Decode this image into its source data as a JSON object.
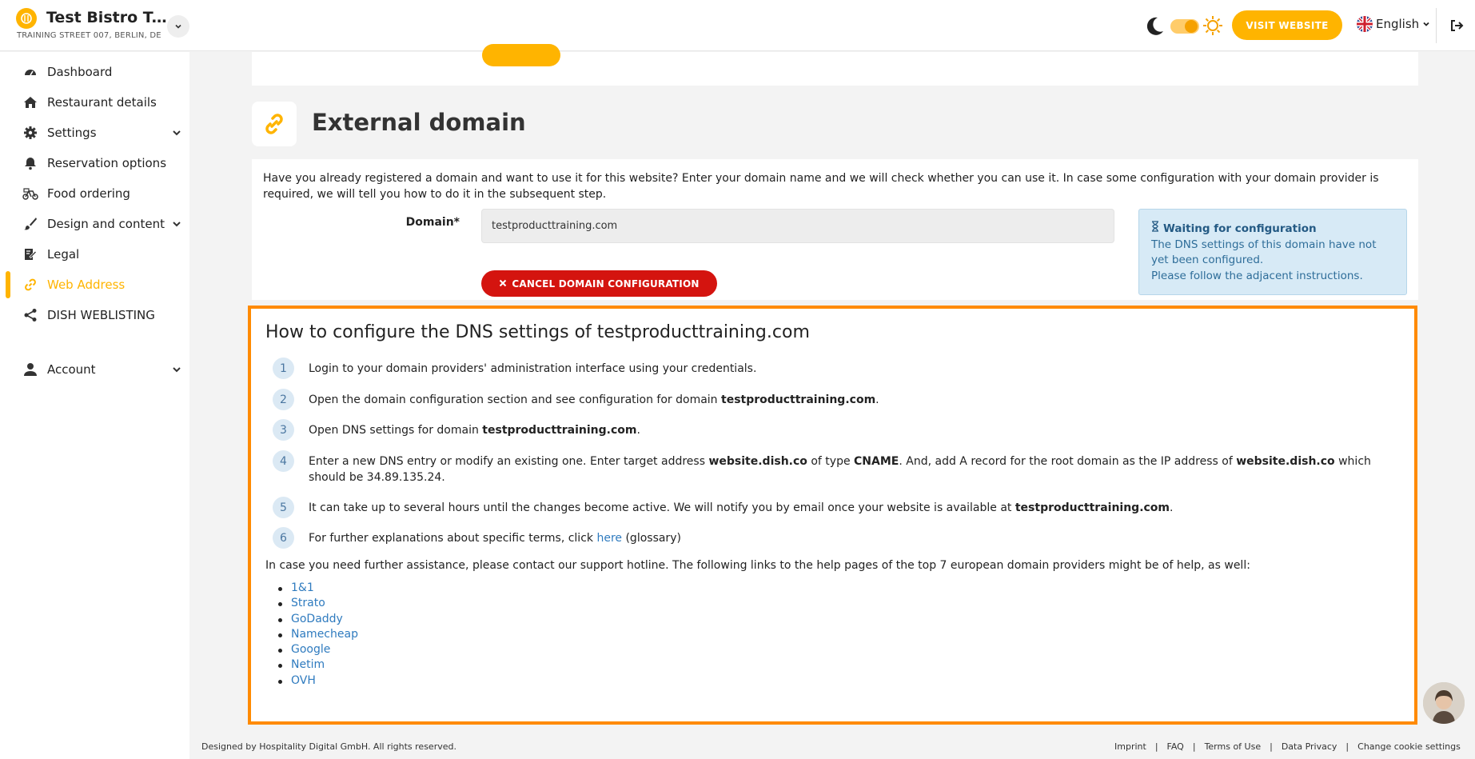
{
  "header": {
    "restaurant_name": "Test Bistro Train...",
    "restaurant_address": "TRAINING STREET 007, BERLIN, DE",
    "visit_website_label": "VISIT WEBSITE",
    "language_label": "English"
  },
  "sidebar": {
    "items": [
      {
        "label": "Dashboard",
        "icon": "dashboard-icon"
      },
      {
        "label": "Restaurant details",
        "icon": "home-icon"
      },
      {
        "label": "Settings",
        "icon": "gear-icon"
      },
      {
        "label": "Reservation options",
        "icon": "bell-icon"
      },
      {
        "label": "Food ordering",
        "icon": "bike-icon"
      },
      {
        "label": "Design and content",
        "icon": "brush-icon"
      },
      {
        "label": "Legal",
        "icon": "legal-icon"
      },
      {
        "label": "Web Address",
        "icon": "link-icon"
      },
      {
        "label": "DISH WEBLISTING",
        "icon": "share-icon"
      },
      {
        "label": "Account",
        "icon": "user-icon"
      }
    ]
  },
  "main": {
    "section_title": "External domain",
    "intro_text": "Have you already registered a domain and want to use it for this website? Enter your domain name and we will check whether you can use it. In case some configuration with your domain provider is required, we will tell you how to do it in the subsequent step.",
    "domain_label": "Domain*",
    "domain_value": "testproducttraining.com",
    "cancel_button_label": "CANCEL DOMAIN CONFIGURATION",
    "status": {
      "title": "Waiting for configuration",
      "line1": "The DNS settings of this domain have not yet been configured.",
      "line2": "Please follow the adjacent instructions."
    }
  },
  "instructions": {
    "title": "How to configure the DNS settings of testproducttraining.com",
    "steps": [
      {
        "num": "1",
        "text": "Login to your domain providers' administration interface using your credentials."
      },
      {
        "num": "2",
        "pre": "Open the domain configuration section and see configuration for domain ",
        "bold": "testproducttraining.com",
        "post": "."
      },
      {
        "num": "3",
        "pre": "Open DNS settings for domain ",
        "bold": "testproducttraining.com",
        "post": "."
      },
      {
        "num": "4",
        "p1": "Enter a new DNS entry or modify an existing one. Enter target address ",
        "b1": "website.dish.co",
        "p2": " of type ",
        "b2": "CNAME",
        "p3": ". And, add A record for the root domain as the IP address of ",
        "b3": "website.dish.co",
        "p4": " which should be 34.89.135.24."
      },
      {
        "num": "5",
        "pre": "It can take up to several hours until the changes become active. We will notify you by email once your website is available at ",
        "bold": "testproducttraining.com",
        "post": "."
      },
      {
        "num": "6",
        "pre": "For further explanations about specific terms, click ",
        "link": "here",
        "post": " (glossary)"
      }
    ],
    "assistance_text": "In case you need further assistance, please contact our support hotline. The following links to the help pages of the top 7 european domain providers might be of help, as well:",
    "providers": [
      "1&1",
      "Strato",
      "GoDaddy",
      "Namecheap",
      "Google",
      "Netim",
      "OVH"
    ]
  },
  "footer": {
    "copyright": "Designed by Hospitality Digital GmbH. All rights reserved.",
    "links": [
      "Imprint",
      "FAQ",
      "Terms of Use",
      "Data Privacy",
      "Change cookie settings"
    ]
  },
  "colors": {
    "accent": "#ffb400",
    "danger": "#d4140f",
    "highlight_border": "#ff8a00",
    "info_bg": "#d7eaf6",
    "link": "#2f7bbf"
  }
}
